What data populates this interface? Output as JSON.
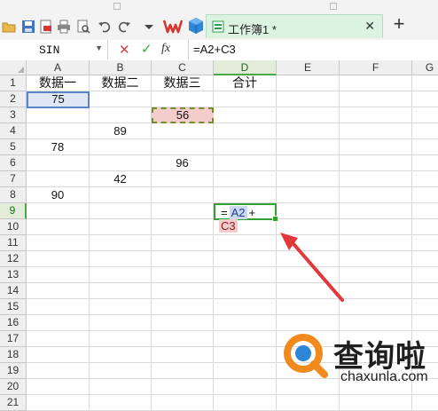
{
  "toolbar": {
    "doc_title": "工作簿1 *",
    "close_glyph": "✕",
    "plus_glyph": "+",
    "icons": [
      "save-icon",
      "export-pdf-icon",
      "print-icon",
      "print-preview-icon",
      "undo-icon",
      "redo-icon",
      "dropdown-icon",
      "wps-logo-icon",
      "cube-icon"
    ]
  },
  "formula_bar": {
    "name_box": "SIN",
    "cancel_glyph": "✕",
    "enter_glyph": "✓",
    "fx_label": "fx",
    "formula": "=A2+C3"
  },
  "grid": {
    "columns": [
      "A",
      "B",
      "C",
      "D",
      "E",
      "F",
      "G"
    ],
    "rows": [
      "1",
      "2",
      "3",
      "4",
      "5",
      "6",
      "7",
      "8",
      "9",
      "10",
      "11",
      "12",
      "13",
      "14",
      "15",
      "16",
      "17",
      "18",
      "19",
      "20",
      "21"
    ],
    "headers": {
      "A1": "数据一",
      "B1": "数据二",
      "C1": "数据三",
      "D1": "合计"
    },
    "values": {
      "A2": "75",
      "C3": "56",
      "B4": "89",
      "A5": "78",
      "C6": "96",
      "B7": "42",
      "A8": "90"
    },
    "edit_cell": {
      "ref": "D9",
      "eq": "=",
      "tok1": "A2",
      "op": "+",
      "tok2": "C3"
    }
  },
  "colors": {
    "active_green": "#33a033",
    "ref_blue": "#5a84c8",
    "ref_red": "#f4cccc",
    "arrow_red": "#e0393b"
  },
  "watermark": {
    "cn": "查询啦",
    "en": "chaxunla.com"
  }
}
